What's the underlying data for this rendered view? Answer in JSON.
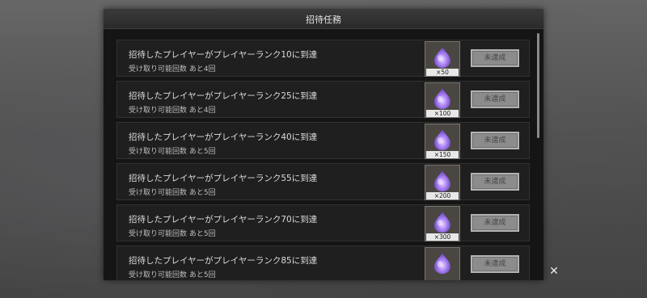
{
  "dialog": {
    "title": "招待任務"
  },
  "missions": [
    {
      "title": "招待したプレイヤーがプレイヤーランク10に到達",
      "claims": "受け取り可能回数 あと4回",
      "reward_count": "×50",
      "status": "未達成"
    },
    {
      "title": "招待したプレイヤーがプレイヤーランク25に到達",
      "claims": "受け取り可能回数 あと4回",
      "reward_count": "×100",
      "status": "未達成"
    },
    {
      "title": "招待したプレイヤーがプレイヤーランク40に到達",
      "claims": "受け取り可能回数 あと5回",
      "reward_count": "×150",
      "status": "未達成"
    },
    {
      "title": "招待したプレイヤーがプレイヤーランク55に到達",
      "claims": "受け取り可能回数 あと5回",
      "reward_count": "×200",
      "status": "未達成"
    },
    {
      "title": "招待したプレイヤーがプレイヤーランク70に到達",
      "claims": "受け取り可能回数 あと5回",
      "reward_count": "×300",
      "status": "未達成"
    },
    {
      "title": "招待したプレイヤーがプレイヤーランク85に到達",
      "claims": "受け取り可能回数 あと5回",
      "reward_count": "",
      "status": "未達成"
    }
  ],
  "icons": {
    "reward": "purple-gem-icon",
    "close": "close-icon"
  },
  "colors": {
    "panel_bg": "#151515",
    "row_bg": "#1f1f1f",
    "button_bg": "#8c8c8c"
  }
}
